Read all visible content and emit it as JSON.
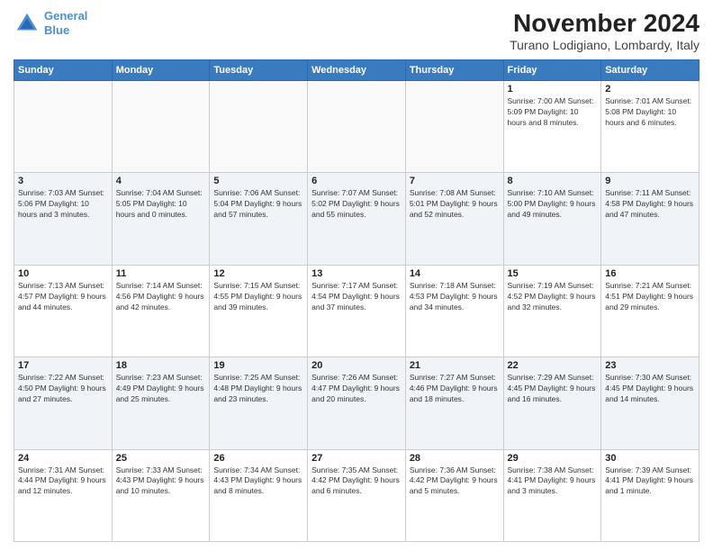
{
  "header": {
    "logo_line1": "General",
    "logo_line2": "Blue",
    "month_title": "November 2024",
    "location": "Turano Lodigiano, Lombardy, Italy"
  },
  "weekdays": [
    "Sunday",
    "Monday",
    "Tuesday",
    "Wednesday",
    "Thursday",
    "Friday",
    "Saturday"
  ],
  "weeks": [
    [
      {
        "day": "",
        "info": "",
        "empty": true
      },
      {
        "day": "",
        "info": "",
        "empty": true
      },
      {
        "day": "",
        "info": "",
        "empty": true
      },
      {
        "day": "",
        "info": "",
        "empty": true
      },
      {
        "day": "",
        "info": "",
        "empty": true
      },
      {
        "day": "1",
        "info": "Sunrise: 7:00 AM\nSunset: 5:09 PM\nDaylight: 10 hours\nand 8 minutes.",
        "empty": false
      },
      {
        "day": "2",
        "info": "Sunrise: 7:01 AM\nSunset: 5:08 PM\nDaylight: 10 hours\nand 6 minutes.",
        "empty": false
      }
    ],
    [
      {
        "day": "3",
        "info": "Sunrise: 7:03 AM\nSunset: 5:06 PM\nDaylight: 10 hours\nand 3 minutes.",
        "empty": false
      },
      {
        "day": "4",
        "info": "Sunrise: 7:04 AM\nSunset: 5:05 PM\nDaylight: 10 hours\nand 0 minutes.",
        "empty": false
      },
      {
        "day": "5",
        "info": "Sunrise: 7:06 AM\nSunset: 5:04 PM\nDaylight: 9 hours\nand 57 minutes.",
        "empty": false
      },
      {
        "day": "6",
        "info": "Sunrise: 7:07 AM\nSunset: 5:02 PM\nDaylight: 9 hours\nand 55 minutes.",
        "empty": false
      },
      {
        "day": "7",
        "info": "Sunrise: 7:08 AM\nSunset: 5:01 PM\nDaylight: 9 hours\nand 52 minutes.",
        "empty": false
      },
      {
        "day": "8",
        "info": "Sunrise: 7:10 AM\nSunset: 5:00 PM\nDaylight: 9 hours\nand 49 minutes.",
        "empty": false
      },
      {
        "day": "9",
        "info": "Sunrise: 7:11 AM\nSunset: 4:58 PM\nDaylight: 9 hours\nand 47 minutes.",
        "empty": false
      }
    ],
    [
      {
        "day": "10",
        "info": "Sunrise: 7:13 AM\nSunset: 4:57 PM\nDaylight: 9 hours\nand 44 minutes.",
        "empty": false
      },
      {
        "day": "11",
        "info": "Sunrise: 7:14 AM\nSunset: 4:56 PM\nDaylight: 9 hours\nand 42 minutes.",
        "empty": false
      },
      {
        "day": "12",
        "info": "Sunrise: 7:15 AM\nSunset: 4:55 PM\nDaylight: 9 hours\nand 39 minutes.",
        "empty": false
      },
      {
        "day": "13",
        "info": "Sunrise: 7:17 AM\nSunset: 4:54 PM\nDaylight: 9 hours\nand 37 minutes.",
        "empty": false
      },
      {
        "day": "14",
        "info": "Sunrise: 7:18 AM\nSunset: 4:53 PM\nDaylight: 9 hours\nand 34 minutes.",
        "empty": false
      },
      {
        "day": "15",
        "info": "Sunrise: 7:19 AM\nSunset: 4:52 PM\nDaylight: 9 hours\nand 32 minutes.",
        "empty": false
      },
      {
        "day": "16",
        "info": "Sunrise: 7:21 AM\nSunset: 4:51 PM\nDaylight: 9 hours\nand 29 minutes.",
        "empty": false
      }
    ],
    [
      {
        "day": "17",
        "info": "Sunrise: 7:22 AM\nSunset: 4:50 PM\nDaylight: 9 hours\nand 27 minutes.",
        "empty": false
      },
      {
        "day": "18",
        "info": "Sunrise: 7:23 AM\nSunset: 4:49 PM\nDaylight: 9 hours\nand 25 minutes.",
        "empty": false
      },
      {
        "day": "19",
        "info": "Sunrise: 7:25 AM\nSunset: 4:48 PM\nDaylight: 9 hours\nand 23 minutes.",
        "empty": false
      },
      {
        "day": "20",
        "info": "Sunrise: 7:26 AM\nSunset: 4:47 PM\nDaylight: 9 hours\nand 20 minutes.",
        "empty": false
      },
      {
        "day": "21",
        "info": "Sunrise: 7:27 AM\nSunset: 4:46 PM\nDaylight: 9 hours\nand 18 minutes.",
        "empty": false
      },
      {
        "day": "22",
        "info": "Sunrise: 7:29 AM\nSunset: 4:45 PM\nDaylight: 9 hours\nand 16 minutes.",
        "empty": false
      },
      {
        "day": "23",
        "info": "Sunrise: 7:30 AM\nSunset: 4:45 PM\nDaylight: 9 hours\nand 14 minutes.",
        "empty": false
      }
    ],
    [
      {
        "day": "24",
        "info": "Sunrise: 7:31 AM\nSunset: 4:44 PM\nDaylight: 9 hours\nand 12 minutes.",
        "empty": false
      },
      {
        "day": "25",
        "info": "Sunrise: 7:33 AM\nSunset: 4:43 PM\nDaylight: 9 hours\nand 10 minutes.",
        "empty": false
      },
      {
        "day": "26",
        "info": "Sunrise: 7:34 AM\nSunset: 4:43 PM\nDaylight: 9 hours\nand 8 minutes.",
        "empty": false
      },
      {
        "day": "27",
        "info": "Sunrise: 7:35 AM\nSunset: 4:42 PM\nDaylight: 9 hours\nand 6 minutes.",
        "empty": false
      },
      {
        "day": "28",
        "info": "Sunrise: 7:36 AM\nSunset: 4:42 PM\nDaylight: 9 hours\nand 5 minutes.",
        "empty": false
      },
      {
        "day": "29",
        "info": "Sunrise: 7:38 AM\nSunset: 4:41 PM\nDaylight: 9 hours\nand 3 minutes.",
        "empty": false
      },
      {
        "day": "30",
        "info": "Sunrise: 7:39 AM\nSunset: 4:41 PM\nDaylight: 9 hours\nand 1 minute.",
        "empty": false
      }
    ]
  ]
}
